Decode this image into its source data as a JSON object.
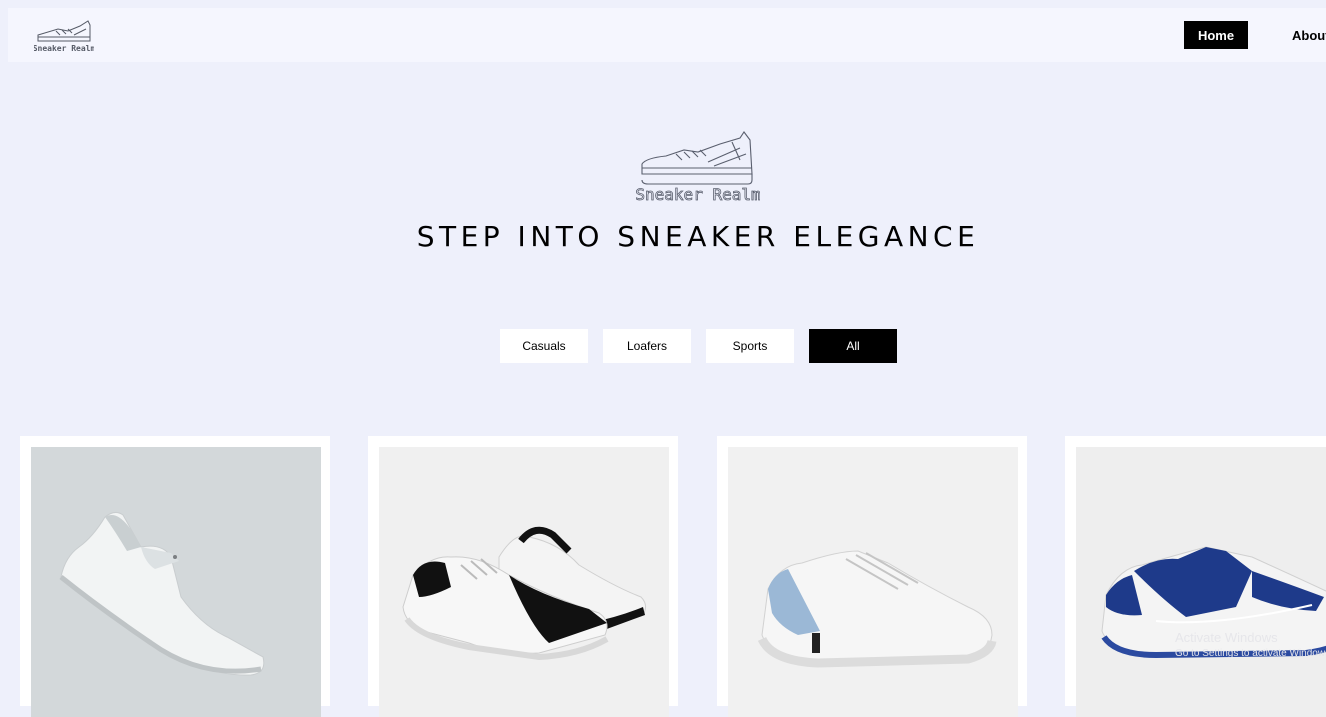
{
  "brand": {
    "logo_text": "Sneaker Realm"
  },
  "nav": {
    "items": [
      {
        "label": "Home",
        "active": true
      },
      {
        "label": "About"
      }
    ]
  },
  "hero": {
    "title": "STEP INTO SNEAKER ELEGANCE"
  },
  "filters": [
    {
      "label": "Casuals"
    },
    {
      "label": "Loafers"
    },
    {
      "label": "Sports"
    },
    {
      "label": "All",
      "active": true
    }
  ],
  "products": [
    {
      "image": "white-grey-sneaker",
      "background": "#d3d8da"
    },
    {
      "image": "white-black-sneakers-pair",
      "background": "#f0f0f0"
    },
    {
      "image": "white-blue-accent-sneaker",
      "background": "#f1f1f1"
    },
    {
      "image": "navy-white-sneaker",
      "background": "#eeeeee"
    }
  ],
  "watermark": {
    "title": "Activate Windows",
    "subtitle": "Go to Settings to activate Windows."
  },
  "colors": {
    "page_bg": "#eef0fb",
    "nav_bg": "#f5f6fe",
    "active_button": "#000000"
  }
}
